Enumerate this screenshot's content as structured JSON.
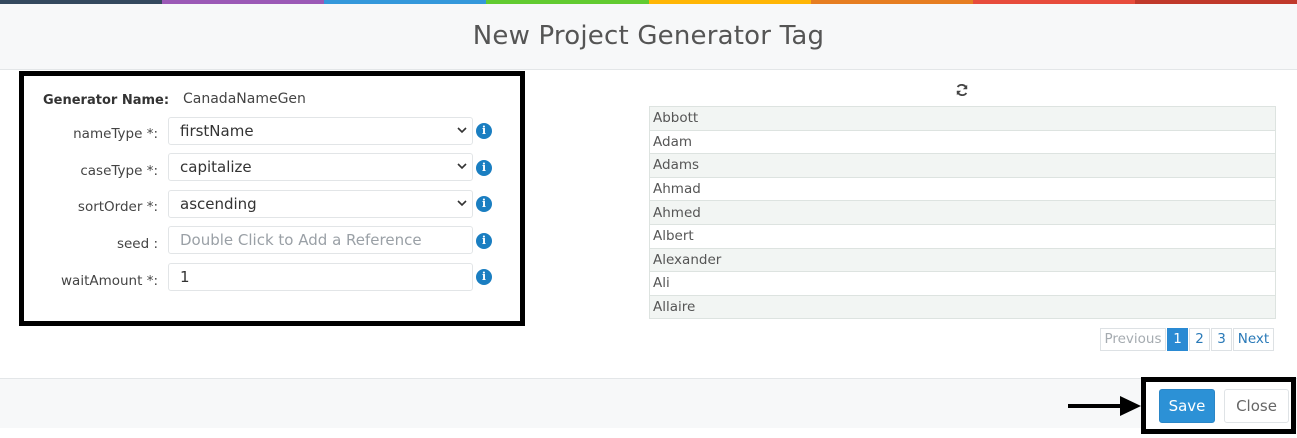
{
  "header": {
    "title": "New Project Generator Tag",
    "strip_colors": [
      "#34495e",
      "#9b59b6",
      "#3498db",
      "#62cb31",
      "#ffb606",
      "#e67e22",
      "#e74c3c",
      "#c0392b"
    ]
  },
  "form": {
    "generator_name_label": "Generator Name:",
    "generator_name_value": "CanadaNameGen",
    "fields": [
      {
        "label": "nameType *:",
        "value": "firstName",
        "type": "select"
      },
      {
        "label": "caseType *:",
        "value": "capitalize",
        "type": "select"
      },
      {
        "label": "sortOrder *:",
        "value": "ascending",
        "type": "select"
      },
      {
        "label": "seed :",
        "placeholder": "Double Click to Add a Reference",
        "type": "input"
      },
      {
        "label": "waitAmount *:",
        "value": "1",
        "type": "input"
      }
    ],
    "info_glyph": "i"
  },
  "preview": {
    "refresh_icon": "refresh-icon",
    "names": [
      "Abbott",
      "Adam",
      "Adams",
      "Ahmad",
      "Ahmed",
      "Albert",
      "Alexander",
      "Ali",
      "Allaire"
    ],
    "pagination": {
      "previous": "Previous",
      "pages": [
        "1",
        "2",
        "3"
      ],
      "next": "Next",
      "active_page": "1"
    }
  },
  "footer": {
    "save_label": "Save",
    "close_label": "Close"
  },
  "colors": {
    "accent": "#2c91d6",
    "info": "#1a7ec1",
    "annotation": "#000000"
  }
}
